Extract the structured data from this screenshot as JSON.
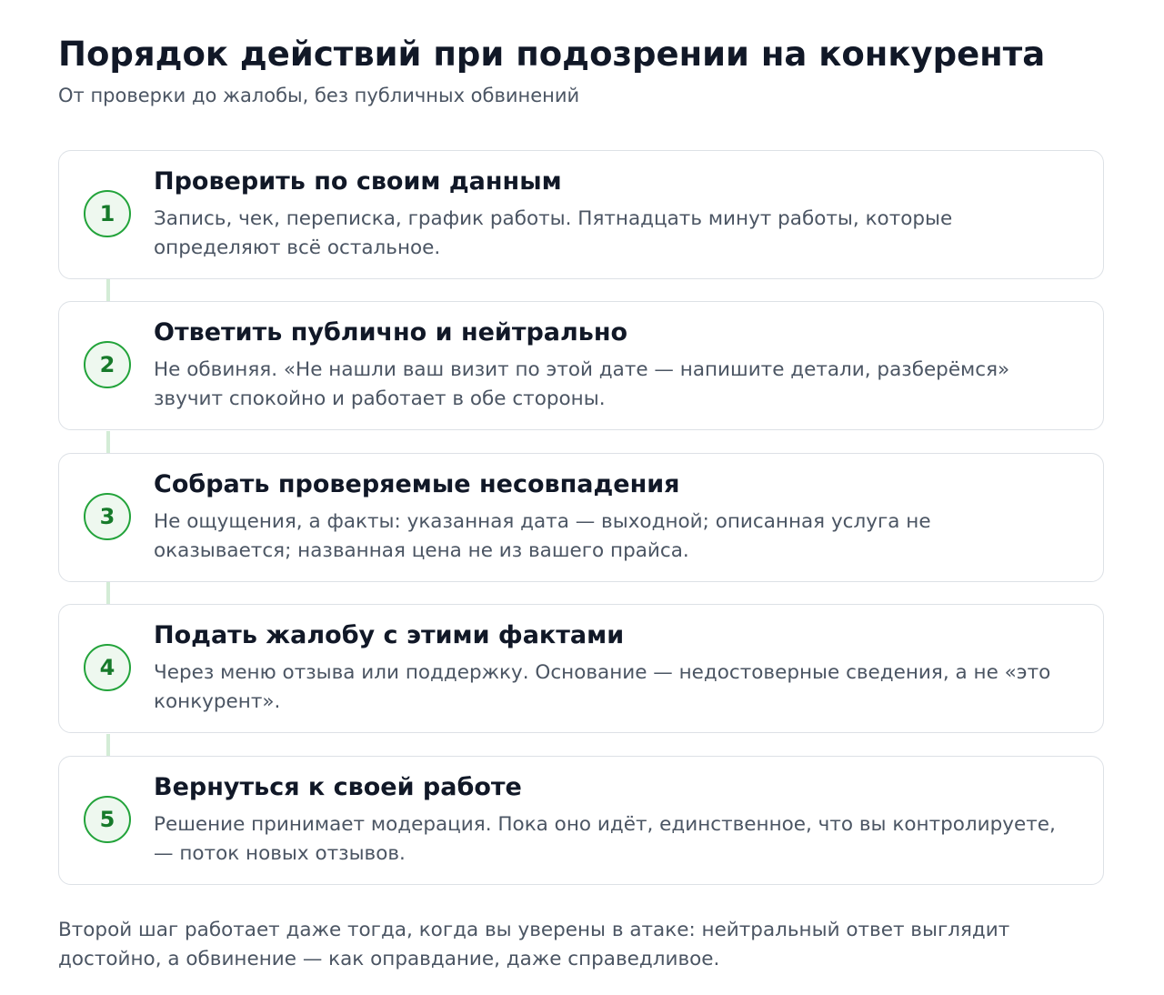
{
  "header": {
    "title": "Порядок действий при подозрении на конкурента",
    "subtitle": "От проверки до жалобы, без публичных обвинений"
  },
  "steps": [
    {
      "number": "1",
      "title": "Проверить по своим данным",
      "description": "Запись, чек, переписка, график работы. Пятнадцать минут работы, которые определяют всё остальное."
    },
    {
      "number": "2",
      "title": "Ответить публично и нейтрально",
      "description": "Не обвиняя. «Не нашли ваш визит по этой дате — напишите детали, разберёмся» звучит спокойно и работает в обе стороны."
    },
    {
      "number": "3",
      "title": "Собрать проверяемые несовпадения",
      "description": "Не ощущения, а факты: указанная дата — выходной; описанная услуга не оказывается; названная цена не из вашего прайса."
    },
    {
      "number": "4",
      "title": "Подать жалобу с этими фактами",
      "description": "Через меню отзыва или поддержку. Основание — недостоверные сведения, а не «это конкурент»."
    },
    {
      "number": "5",
      "title": "Вернуться к своей работе",
      "description": "Решение принимает модерация. Пока оно идёт, единственное, что вы контролируете, — поток новых отзывов."
    }
  ],
  "footnote": "Второй шаг работает даже тогда, когда вы уверены в атаке: нейтральный ответ выглядит достойно, а обвинение — как оправдание, даже справедливое.",
  "colors": {
    "accent": "#22a33a",
    "accent_text": "#167a2a",
    "badge_fill": "#eef8ef",
    "connector": "#d3ecd6",
    "card_border": "#dde1e6",
    "title_text": "#111827",
    "body_text": "#4b5563"
  }
}
